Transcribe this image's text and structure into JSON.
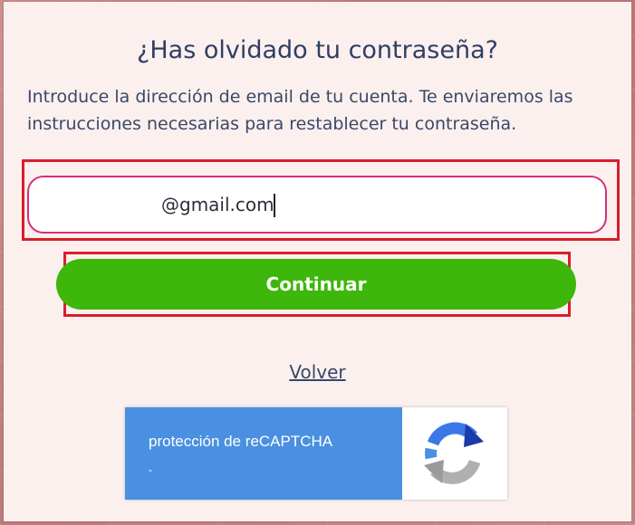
{
  "dialog": {
    "title": "¿Has olvidado tu contraseña?",
    "description": "Introduce la dirección de email de tu cuenta. Te enviaremos las instrucciones necesarias para restablecer tu contraseña."
  },
  "email_field": {
    "value": "@gmail.com"
  },
  "continue_button": {
    "label": "Continuar"
  },
  "back_link": {
    "label": "Volver"
  },
  "recaptcha": {
    "label": "protección de reCAPTCHA",
    "sublabel": "-",
    "icon": "recaptcha-logo-icon"
  },
  "colors": {
    "title": "#2f3f63",
    "button": "#3db70b",
    "highlight": "#d81e2b",
    "input_border": "#d62f7a",
    "recaptcha_blue": "#4a90e2"
  }
}
